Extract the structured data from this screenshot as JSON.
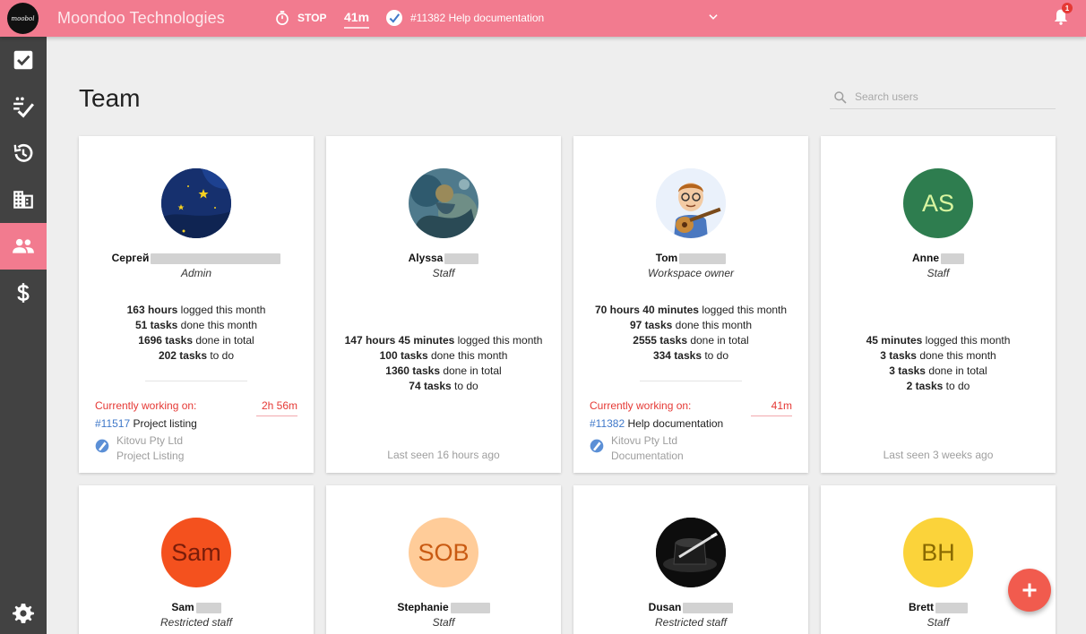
{
  "app": {
    "logo_text": "moobol",
    "title": "Moondoo Technologies",
    "stop_label": "STOP",
    "elapsed": "41m",
    "current_task": "#11382  Help documentation",
    "notification_count": "1"
  },
  "sidebar": {
    "items": [
      {
        "name": "tasks",
        "icon": "checkbox-icon"
      },
      {
        "name": "done",
        "icon": "checklist-icon"
      },
      {
        "name": "history",
        "icon": "history-icon"
      },
      {
        "name": "clients",
        "icon": "building-icon"
      },
      {
        "name": "team",
        "icon": "people-icon",
        "active": true
      },
      {
        "name": "billing",
        "icon": "dollar-icon"
      },
      {
        "name": "settings",
        "icon": "gear-icon"
      }
    ]
  },
  "page": {
    "title": "Team",
    "search_placeholder": "Search users"
  },
  "members": [
    {
      "name": "Сергей",
      "role": "Admin",
      "stat1_b": "163 hours",
      "stat1": " logged this month",
      "stat2_b": "51 tasks",
      "stat2": " done this month",
      "stat3_b": "1696 tasks",
      "stat3": " done in total",
      "stat4_b": "202 tasks",
      "stat4": " to do",
      "working_label": "Currently working on:",
      "working_time": "2h 56m",
      "task_num": "#11517",
      "task_name": " Project listing",
      "client": "Kitovu Pty Ltd",
      "project": "Project Listing"
    },
    {
      "name": "Alyssa",
      "role": "Staff",
      "stat1_b": "147 hours 45 minutes",
      "stat1": " logged this month",
      "stat2_b": "100 tasks",
      "stat2": " done this month",
      "stat3_b": "1360 tasks",
      "stat3": " done in total",
      "stat4_b": "74 tasks",
      "stat4": " to do",
      "last_seen": "Last seen 16 hours ago"
    },
    {
      "name": "Tom",
      "role": "Workspace owner",
      "stat1_b": "70 hours 40 minutes",
      "stat1": " logged this month",
      "stat2_b": "97 tasks",
      "stat2": " done this month",
      "stat3_b": "2555 tasks",
      "stat3": " done in total",
      "stat4_b": "334 tasks",
      "stat4": " to do",
      "working_label": "Currently working on:",
      "working_time": "41m",
      "task_num": "#11382",
      "task_name": " Help documentation",
      "client": "Kitovu Pty Ltd",
      "project": "Documentation"
    },
    {
      "name": "Anne",
      "role": "Staff",
      "initials": "AS",
      "avatar_color": "#2e7d4f",
      "initials_color": "#d9f5a0",
      "stat1_b": "45 minutes",
      "stat1": " logged this month",
      "stat2_b": "3 tasks",
      "stat2": " done this month",
      "stat3_b": "3 tasks",
      "stat3": " done in total",
      "stat4_b": "2 tasks",
      "stat4": " to do",
      "last_seen": "Last seen 3 weeks ago"
    },
    {
      "name": "Sam",
      "role": "Restricted staff",
      "initials": "Sam",
      "avatar_color": "#f4511e",
      "initials_color": "#7a1d0a"
    },
    {
      "name": "Stephanie",
      "role": "Staff",
      "initials": "SOB",
      "avatar_color": "#ffcc99",
      "initials_color": "#c95a12"
    },
    {
      "name": "Dusan",
      "role": "Restricted staff"
    },
    {
      "name": "Brett",
      "role": "Staff",
      "initials": "BH",
      "avatar_color": "#fbd33a",
      "initials_color": "#8a6a00"
    }
  ]
}
